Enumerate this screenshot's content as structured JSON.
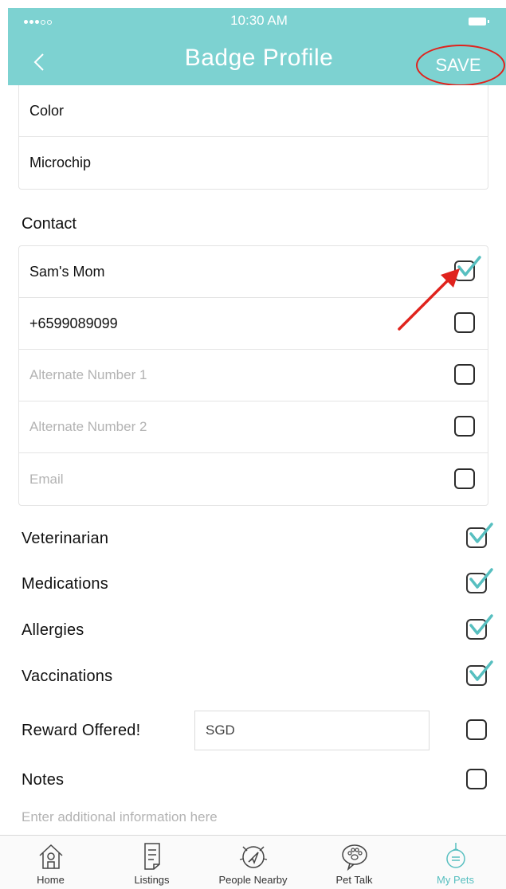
{
  "status_bar": {
    "time": "10:30 AM"
  },
  "header": {
    "title": "Badge Profile",
    "save_label": "SAVE"
  },
  "details": {
    "rows": [
      {
        "label": "Color"
      },
      {
        "label": "Microchip"
      }
    ]
  },
  "contact": {
    "title": "Contact",
    "rows": [
      {
        "label": "Sam's Mom",
        "checked": true,
        "placeholder": false
      },
      {
        "label": "+6599089099",
        "checked": false,
        "placeholder": false
      },
      {
        "label": "Alternate Number 1",
        "checked": false,
        "placeholder": true
      },
      {
        "label": "Alternate Number 2",
        "checked": false,
        "placeholder": true
      },
      {
        "label": "Email",
        "checked": false,
        "placeholder": true
      }
    ]
  },
  "toggles": {
    "veterinarian": {
      "label": "Veterinarian",
      "checked": true
    },
    "medications": {
      "label": "Medications",
      "checked": true
    },
    "allergies": {
      "label": "Allergies",
      "checked": true
    },
    "vaccinations": {
      "label": "Vaccinations",
      "checked": true
    },
    "reward": {
      "label": "Reward Offered!",
      "checked": false,
      "input_value": "SGD"
    },
    "notes": {
      "label": "Notes",
      "checked": false,
      "placeholder": "Enter additional information here"
    }
  },
  "tab_bar": {
    "tabs": [
      {
        "label": "Home",
        "icon": "home-icon"
      },
      {
        "label": "Listings",
        "icon": "listings-icon"
      },
      {
        "label": "People Nearby",
        "icon": "people-nearby-icon"
      },
      {
        "label": "Pet Talk",
        "icon": "pet-talk-icon"
      },
      {
        "label": "My Pets",
        "icon": "my-pets-icon",
        "active": true
      }
    ]
  },
  "colors": {
    "header_bg": "#7dd2d1",
    "accent": "#57bfc0",
    "annotation_red": "#e0231d"
  }
}
